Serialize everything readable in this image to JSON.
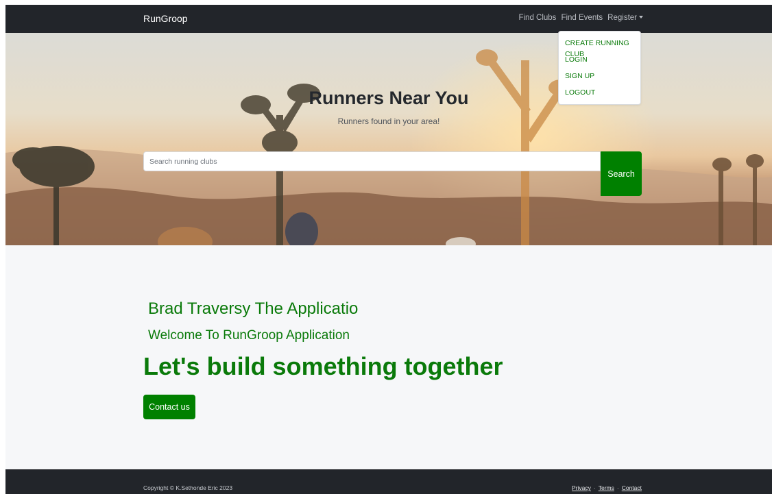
{
  "navbar": {
    "brand": "RunGroop",
    "links": [
      "Find Clubs",
      "Find Events",
      "Register"
    ]
  },
  "dropdown": {
    "items": [
      "CREATE RUNNING CLUB",
      "LOGIN",
      "SIGN UP",
      "LOGOUT"
    ]
  },
  "hero": {
    "title": "Runners Near You",
    "subtitle": "Runners found in your area!",
    "search_placeholder": "Search running clubs",
    "search_button": "Search"
  },
  "main": {
    "line1": "Brad Traversy The Applicatio",
    "line2": "Welcome To RunGroop Application",
    "line3": "Let's build something together",
    "contact_button": "Contact us"
  },
  "footer": {
    "copyright": "Copyright © K.Sethonde Eric 2023",
    "links": [
      "Privacy",
      "Terms",
      "Contact"
    ],
    "separator": "·"
  },
  "colors": {
    "navbar": "#22252a",
    "accent_green": "#008000",
    "text_green": "#0a7a0a",
    "page_bg": "#f6f7f9"
  }
}
